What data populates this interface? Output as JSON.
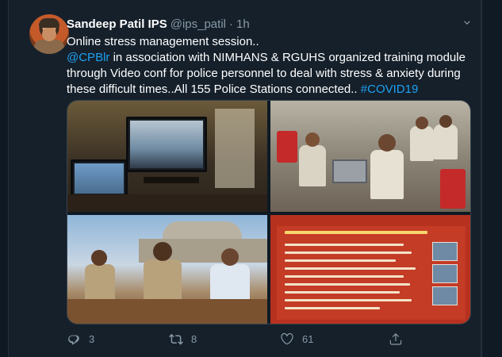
{
  "tweet": {
    "author_name": "Sandeep Patil IPS",
    "handle": "@ips_patil",
    "separator": "·",
    "time": "1h",
    "text_lines": [
      "Online stress management session..",
      {
        "mention": "@CPBlr",
        "rest": " in association with NIMHANS & RGUHS organized  training module"
      },
      "through Video conf for police personnel to deal with stress & anxiety during",
      {
        "text": "these difficult times..All 155 Police Stations connected.. ",
        "hashtag": "#COVID19"
      }
    ]
  },
  "media": {
    "images": [
      {
        "name": "video-conference-monitors"
      },
      {
        "name": "police-personnel-seated"
      },
      {
        "name": "officers-at-table"
      },
      {
        "name": "presentation-slide"
      }
    ]
  },
  "actions": {
    "reply_count": "3",
    "retweet_count": "8",
    "like_count": "61"
  },
  "icons": {
    "reply": "reply-icon",
    "retweet": "retweet-icon",
    "like": "heart-icon",
    "share": "share-icon",
    "more": "chevron-down-icon"
  },
  "colors": {
    "background": "#15202b",
    "link": "#1da1f2",
    "muted": "#8899a6"
  }
}
